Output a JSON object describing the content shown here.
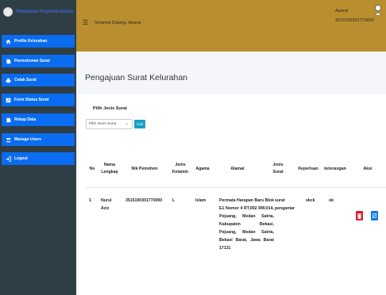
{
  "brand": {
    "title": "Pelayanan Kependudukan"
  },
  "header": {
    "welcome": "Selamat Datang, Aparat",
    "user_name": "Aparat",
    "user_id": "3515100301770002"
  },
  "sidebar": {
    "items": [
      {
        "label": "Profile Kelurahan",
        "icon": "home-icon"
      },
      {
        "label": "Permohonan Surat",
        "icon": "document-icon"
      },
      {
        "label": "Cetak Surat",
        "icon": "print-icon"
      },
      {
        "label": "Form Status Surat",
        "icon": "edit-icon"
      },
      {
        "label": "Rekap Data",
        "icon": "document-icon"
      },
      {
        "label": "Manage Users",
        "icon": "users-icon"
      },
      {
        "label": "Logout",
        "icon": "logout-icon"
      }
    ]
  },
  "page": {
    "title": "Pengajuan Surat Kelurahan"
  },
  "filter": {
    "label": "Pilih Jenis Surat",
    "select_value": "Pilih Jenis Surat",
    "button_label": "Cari"
  },
  "table": {
    "headers": [
      "No",
      "Nama Lengkap",
      "Nik Pemohon",
      "Jenis Kelamin",
      "Agama",
      "Alamat",
      "Jenis Surat",
      "Keperluan",
      "keterangan",
      "Aksi"
    ],
    "rows": [
      {
        "no": "1",
        "nama": "Nurul Aziz",
        "nik": "3515100301770000",
        "jk": "L",
        "agama": "Islam",
        "alamat": "Permata Harapan Baru Blok E1 Nomor 4 RT.002 RW.014, Pejuang, Medan Satria, Kabupaten Bekasi, Pejuang, Medan Satria, Bekasi Barat, Jawa Barat 17131",
        "jenis_surat": "surat pengantar",
        "keperluan": "skck",
        "keterangan": "ok"
      }
    ]
  },
  "colors": {
    "sidebar_bg": "#2f3d44",
    "nav_active": "#0a6cf0",
    "topbar_bg": "#b98e2f",
    "delete": "#dc1e35",
    "edit": "#0a79e8",
    "search_button": "#1aa0c2"
  }
}
